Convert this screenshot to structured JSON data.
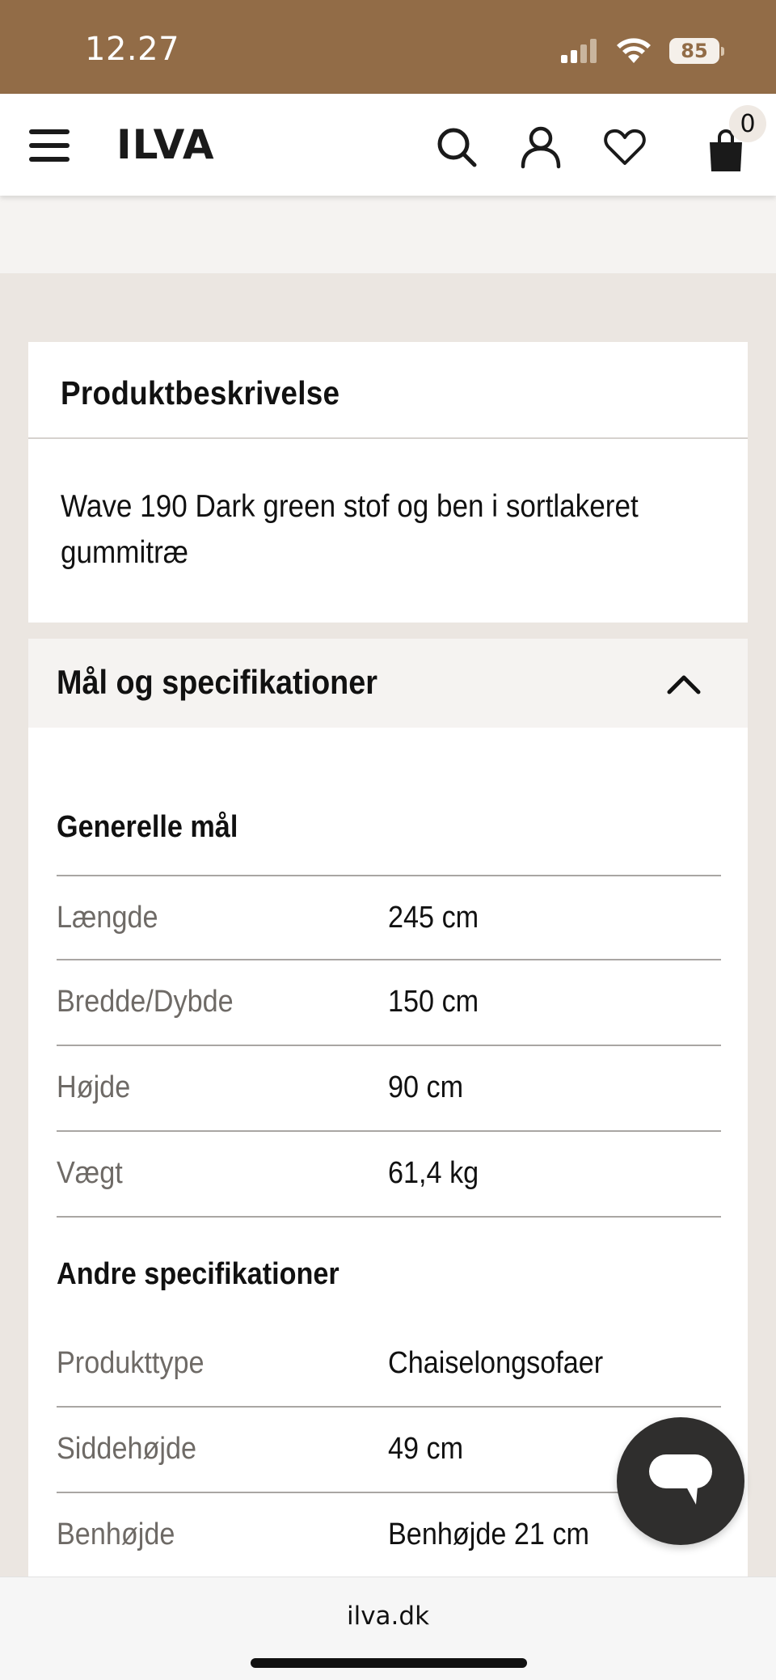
{
  "status_bar": {
    "time": "12.27",
    "battery": "85",
    "background_color": "#926c47"
  },
  "header": {
    "logo_text": "ILVA",
    "cart_count": "0",
    "icons": [
      "menu-icon",
      "search-icon",
      "user-icon",
      "heart-icon",
      "bag-icon"
    ]
  },
  "description": {
    "title": "Produktbeskrivelse",
    "text": "Wave 190 Dark green stof og ben i sortlakeret gummitræ"
  },
  "specs": {
    "title": "Mål og specifikationer",
    "general_title": "Generelle mål",
    "general": [
      {
        "label": "Længde",
        "value": "245 cm"
      },
      {
        "label": "Bredde/Dybde",
        "value": "150 cm"
      },
      {
        "label": "Højde",
        "value": "90 cm"
      },
      {
        "label": "Vægt",
        "value": "61,4 kg"
      }
    ],
    "other_title": "Andre specifikationer",
    "other": [
      {
        "label": "Produkttype",
        "value": "Chaiselongsofaer"
      },
      {
        "label": "Siddehøjde",
        "value": "49 cm"
      },
      {
        "label": "Benhøjde",
        "value": "Benhøjde 21 cm"
      }
    ]
  },
  "browser": {
    "url": "ilva.dk"
  }
}
